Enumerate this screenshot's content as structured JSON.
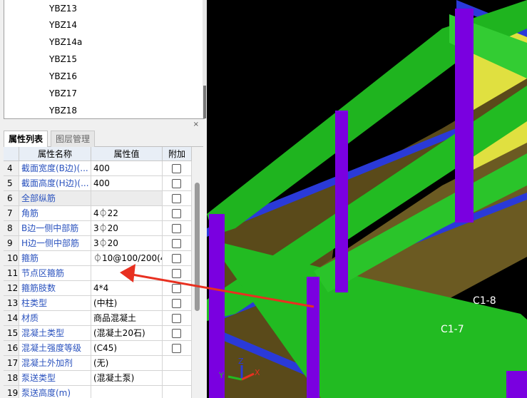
{
  "tree": {
    "items": [
      "YBZ13",
      "YBZ14",
      "YBZ14a",
      "YBZ15",
      "YBZ16",
      "YBZ17",
      "YBZ18"
    ]
  },
  "panel": {
    "close_glyph": "×",
    "tabs": [
      "属性列表",
      "图层管理"
    ],
    "columns": {
      "name": "属性名称",
      "value": "属性值",
      "extra": "附加"
    }
  },
  "properties": [
    {
      "num": "4",
      "name": "截面宽度(B边)(...",
      "value": "400",
      "check": true
    },
    {
      "num": "5",
      "name": "截面高度(H边)(...",
      "value": "400",
      "check": true
    },
    {
      "num": "6",
      "name": "全部纵筋",
      "value": "",
      "check": true,
      "grey": true
    },
    {
      "num": "7",
      "name": "角筋",
      "value": "4⏀22",
      "check": true
    },
    {
      "num": "8",
      "name": "B边一侧中部筋",
      "value": "3⏀20",
      "check": true
    },
    {
      "num": "9",
      "name": "H边一侧中部筋",
      "value": "3⏀20",
      "check": true
    },
    {
      "num": "10",
      "name": "箍筋",
      "value": "⏀10@100/200(4",
      "check": true
    },
    {
      "num": "11",
      "name": "节点区箍筋",
      "value": "",
      "check": true
    },
    {
      "num": "12",
      "name": "箍筋肢数",
      "value": "4*4",
      "check": true
    },
    {
      "num": "13",
      "name": "柱类型",
      "value": "(中柱)",
      "check": true
    },
    {
      "num": "14",
      "name": "材质",
      "value": "商品混凝土",
      "check": true
    },
    {
      "num": "15",
      "name": "混凝土类型",
      "value": "(混凝土20石)",
      "check": true
    },
    {
      "num": "16",
      "name": "混凝土强度等级",
      "value": "(C45)",
      "check": true
    },
    {
      "num": "17",
      "name": "混凝土外加剂",
      "value": "(无)",
      "check": false
    },
    {
      "num": "18",
      "name": "泵送类型",
      "value": "(混凝土泵)",
      "check": false
    },
    {
      "num": "19",
      "name": "泵送高度(m)",
      "value": "",
      "check": false
    }
  ],
  "viewport": {
    "labels": [
      "C1-8",
      "C1-7"
    ],
    "axis": {
      "y": "Y",
      "z": "Z",
      "x": "X"
    },
    "colors": {
      "beam": "#22bb22",
      "column": "#7a00e0",
      "slab": "#e0e040",
      "wall": "#5a4a1a",
      "tie": "#2a3ad8",
      "arrow": "#e83020"
    }
  }
}
